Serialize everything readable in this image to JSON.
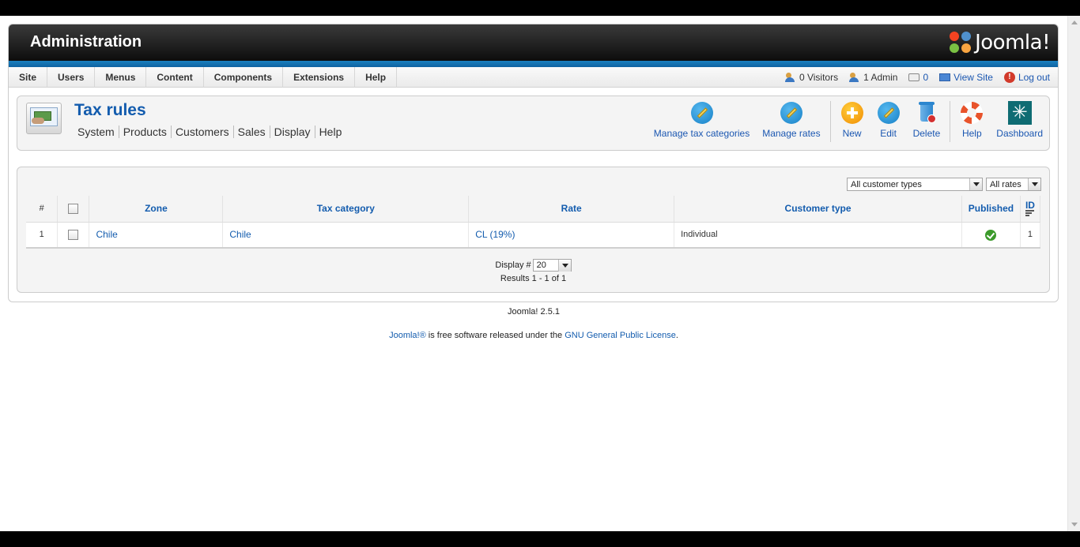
{
  "header": {
    "title": "Administration",
    "logo_text": "Joomla!"
  },
  "menu": {
    "items": [
      "Site",
      "Users",
      "Menus",
      "Content",
      "Components",
      "Extensions",
      "Help"
    ]
  },
  "status": {
    "visitors": "0 Visitors",
    "admins": "1 Admin",
    "messages": "0",
    "view_site": "View Site",
    "logout": "Log out"
  },
  "page": {
    "title": "Tax rules",
    "submenu": [
      "System",
      "Products",
      "Customers",
      "Sales",
      "Display",
      "Help"
    ]
  },
  "toolbar": {
    "manage_tax_categories": "Manage tax categories",
    "manage_rates": "Manage rates",
    "new": "New",
    "edit": "Edit",
    "delete": "Delete",
    "help": "Help",
    "dashboard": "Dashboard"
  },
  "filters": {
    "customer_type": "All customer types",
    "rates": "All rates"
  },
  "table": {
    "columns": {
      "num": "#",
      "zone": "Zone",
      "tax_category": "Tax category",
      "rate": "Rate",
      "customer_type": "Customer type",
      "published": "Published",
      "id": "ID"
    },
    "rows": [
      {
        "num": "1",
        "zone": "Chile",
        "tax_category": "Chile",
        "rate": "CL (19%)",
        "customer_type": "Individual",
        "published": true,
        "id": "1"
      }
    ]
  },
  "pagination": {
    "display_label": "Display #",
    "display_value": "20",
    "results": "Results 1 - 1 of 1"
  },
  "footer": {
    "version": "Joomla! 2.5.1",
    "brand_link": "Joomla!®",
    "license_text": " is free software released under the ",
    "license_link": "GNU General Public License",
    "period": "."
  },
  "colors": {
    "accent_blue": "#135cae",
    "header_dark": "#0d0d0d",
    "strip_blue": "#1a80bf",
    "published_green": "#3c9a2b"
  }
}
